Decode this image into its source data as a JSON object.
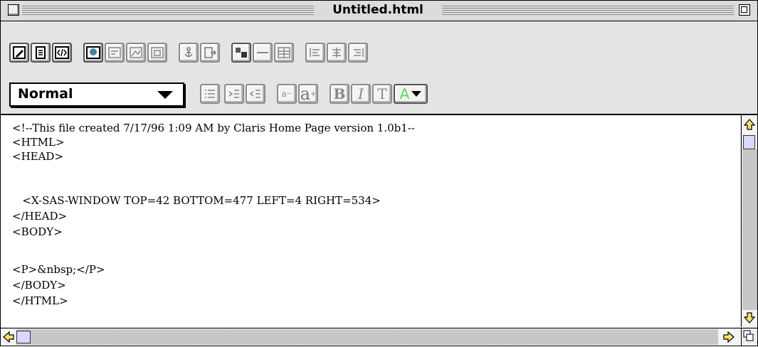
{
  "window": {
    "title": "Untitled.html"
  },
  "toolbar_row1": [
    {
      "name": "edit-mode-icon"
    },
    {
      "name": "document-icon"
    },
    {
      "name": "html-source-icon"
    },
    {
      "name": "globe-link-icon"
    },
    {
      "name": "form-field-icon"
    },
    {
      "name": "image-icon"
    },
    {
      "name": "frame-icon"
    },
    {
      "name": "anchor-icon"
    },
    {
      "name": "document-link-icon"
    },
    {
      "name": "insert-image-icon"
    },
    {
      "name": "horizontal-rule-icon"
    },
    {
      "name": "table-icon"
    },
    {
      "name": "align-left-icon"
    },
    {
      "name": "align-center-icon"
    },
    {
      "name": "align-right-icon"
    }
  ],
  "paragraph_style": {
    "selected": "Normal"
  },
  "toolbar_row2": {
    "smaller_label": "a",
    "larger_label": "a",
    "bold_label": "B",
    "italic_label": "I",
    "teletype_label": "T",
    "color_label": "A",
    "color_accent": "#55dd55"
  },
  "editor": {
    "lines": [
      "<!--This file created 7/17/96 1:09 AM by Claris Home Page version 1.0b1--",
      "<HTML>",
      "<HEAD>",
      "",
      "   <X-SAS-WINDOW TOP=42 BOTTOM=477 LEFT=4 RIGHT=534>",
      "</HEAD>",
      "<BODY>",
      "",
      "<P>&nbsp;</P>",
      "</BODY>",
      "</HTML>"
    ]
  }
}
